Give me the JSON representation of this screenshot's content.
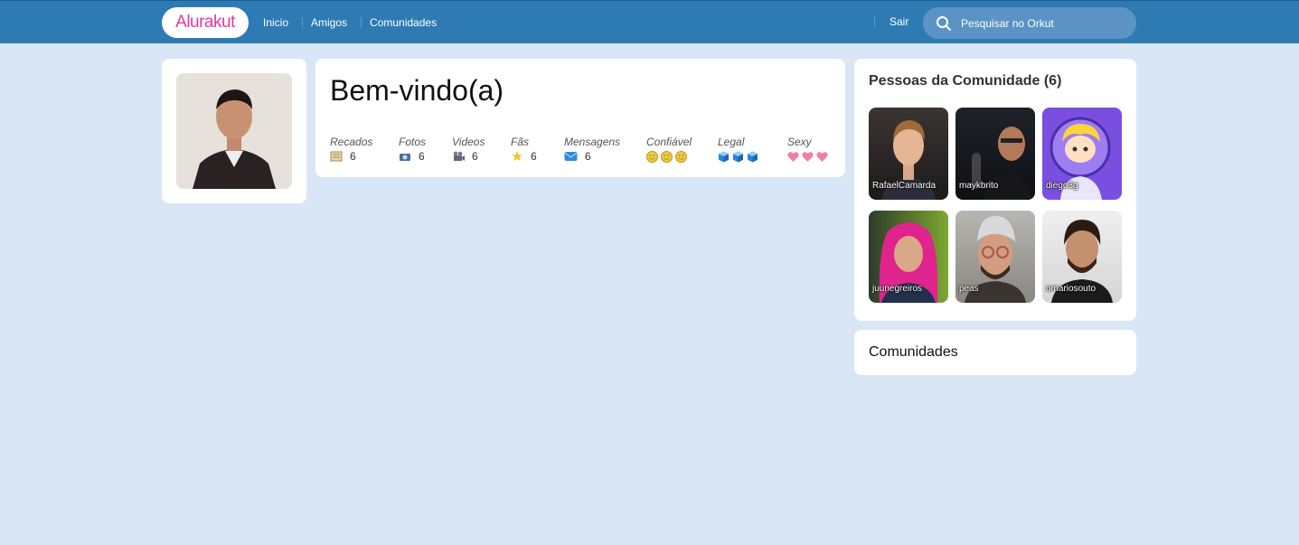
{
  "header": {
    "logo": "Alurakut",
    "nav": [
      "Inicio",
      "Amigos",
      "Comunidades"
    ],
    "logout": "Sair",
    "search_placeholder": "Pesquisar no Orkut"
  },
  "welcome": {
    "title": "Bem-vindo(a)",
    "stats": [
      {
        "label": "Recados",
        "value": "6",
        "icon": "scroll-icon"
      },
      {
        "label": "Fotos",
        "value": "6",
        "icon": "camera-icon"
      },
      {
        "label": "Videos",
        "value": "6",
        "icon": "video-camera-icon"
      },
      {
        "label": "Fãs",
        "value": "6",
        "icon": "star-icon"
      },
      {
        "label": "Mensagens",
        "value": "6",
        "icon": "mail-icon"
      }
    ],
    "ratings": [
      {
        "label": "Confiável",
        "icon": "smiley-icon",
        "count": 3
      },
      {
        "label": "Legal",
        "icon": "ice-cube-icon",
        "count": 3
      },
      {
        "label": "Sexy",
        "icon": "heart-icon",
        "count": 3
      }
    ]
  },
  "people": {
    "title": "Pessoas da Comunidade (6)",
    "items": [
      {
        "name": "RafaelCamarda"
      },
      {
        "name": "maykbrito"
      },
      {
        "name": "diego3g"
      },
      {
        "name": "juunegreiros"
      },
      {
        "name": "peas"
      },
      {
        "name": "omariosouto"
      }
    ]
  },
  "communities": {
    "title": "Comunidades"
  },
  "colors": {
    "header": "#2e7bb4",
    "background": "#d9e6f6",
    "logo_text": "#e03aa0"
  }
}
